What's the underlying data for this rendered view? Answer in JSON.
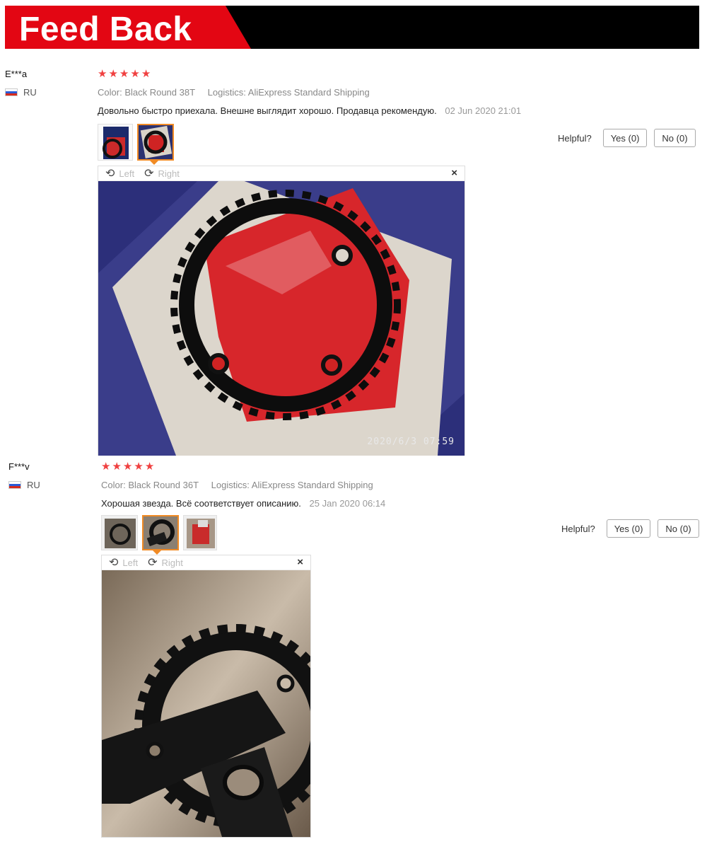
{
  "banner": {
    "title": "Feed Back"
  },
  "reviews": [
    {
      "user": "E***a",
      "country": "RU",
      "stars": [
        "★",
        "★",
        "★",
        "★",
        "★"
      ],
      "color_label": "Color:",
      "color_value": "Black Round 38T",
      "logistics_label": "Logistics:",
      "logistics_value": "AliExpress Standard Shipping",
      "text": "Довольно быстро приехала. Внешне выглядит хорошо. Продавца рекомендую.",
      "date": "02 Jun 2020 21:01",
      "helpful_label": "Helpful?",
      "yes_label": "Yes (0)",
      "no_label": "No (0)",
      "viewer": {
        "left_label": "Left",
        "right_label": "Right",
        "close": "×",
        "stamp": "2020/6/3  07:59"
      }
    },
    {
      "user": "F***v",
      "country": "RU",
      "stars": [
        "★",
        "★",
        "★",
        "★",
        "★"
      ],
      "color_label": "Color:",
      "color_value": "Black Round 36T",
      "logistics_label": "Logistics:",
      "logistics_value": "AliExpress Standard Shipping",
      "text": "Хорошая звезда. Всё соответствует описанию.",
      "date": "25 Jan 2020 06:14",
      "helpful_label": "Helpful?",
      "yes_label": "Yes (0)",
      "no_label": "No (0)",
      "viewer": {
        "left_label": "Left",
        "right_label": "Right",
        "close": "×"
      }
    }
  ],
  "colors": {
    "banner_red": "#e30613",
    "star": "#f04040",
    "active_thumb": "#f08a24"
  }
}
